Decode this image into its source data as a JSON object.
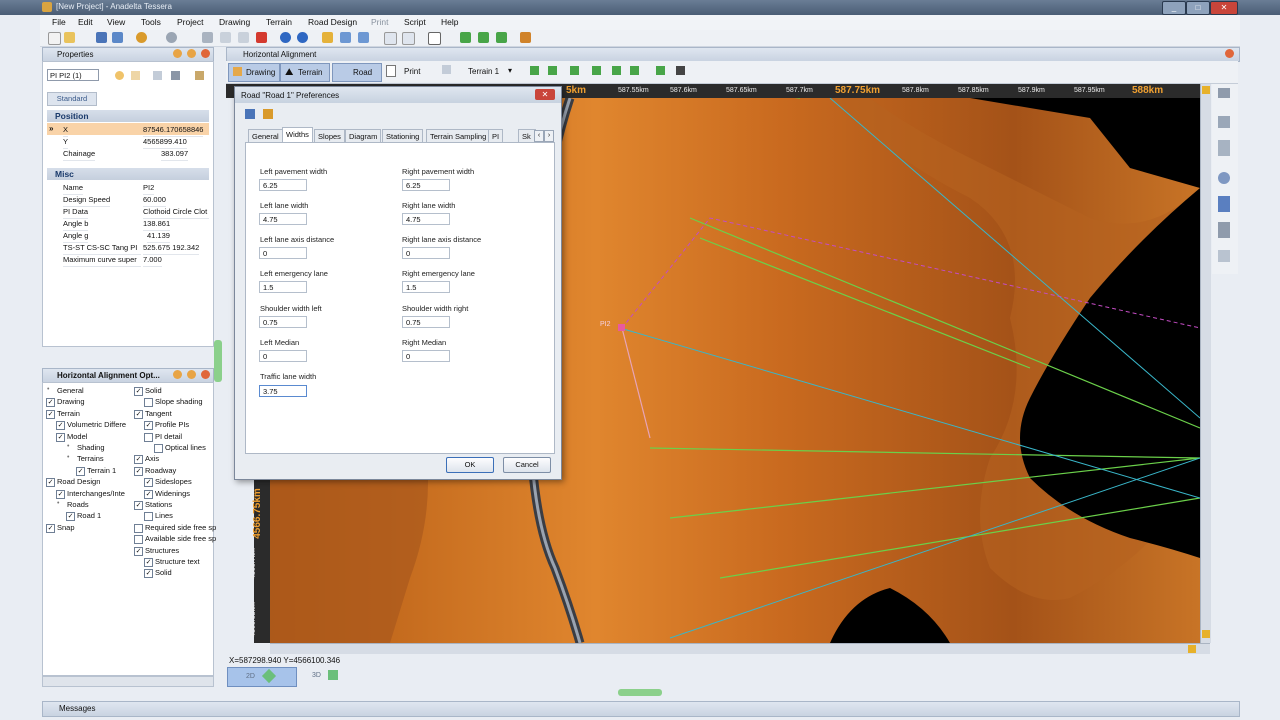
{
  "window": {
    "title": "[New Project] - Anadelta Tessera",
    "min": "_",
    "max": "□",
    "close": "✕"
  },
  "menu": [
    "File",
    "Edit",
    "View",
    "Tools",
    "Project",
    "Drawing",
    "Terrain",
    "Road Design",
    "Print",
    "Script",
    "Help"
  ],
  "properties": {
    "header": "Properties",
    "selector": "PI PI2 (1)",
    "tab": "Standard",
    "position": {
      "title": "Position",
      "rows": [
        [
          "X",
          "87546.170658846"
        ],
        [
          "Y",
          "4565899.410"
        ],
        [
          "Chainage",
          "383.097"
        ]
      ]
    },
    "misc": {
      "title": "Misc",
      "rows": [
        [
          "Name",
          "PI2"
        ],
        [
          "Design Speed",
          "60.000"
        ],
        [
          "PI Data",
          "Clothoid Circle Clot"
        ],
        [
          "Angle b",
          "138.861"
        ],
        [
          "Angle g",
          "41.139"
        ],
        [
          "TS-ST CS-SC Tang PI",
          "525.675  192.342"
        ],
        [
          "Maximum curve super",
          "7.000"
        ]
      ]
    }
  },
  "options": {
    "header": "Horizontal Alignment Opt...",
    "left": [
      {
        "label": "General",
        "indent": 0,
        "cb": null
      },
      {
        "label": "Drawing",
        "indent": 0,
        "cb": true
      },
      {
        "label": "Terrain",
        "indent": 0,
        "cb": true
      },
      {
        "label": "Volumetric Differe",
        "indent": 1,
        "cb": true
      },
      {
        "label": "Model",
        "indent": 1,
        "cb": true
      },
      {
        "label": "Shading",
        "indent": 2,
        "cb": null
      },
      {
        "label": "Terrains",
        "indent": 2,
        "cb": null
      },
      {
        "label": "Terrain 1",
        "indent": 3,
        "cb": true
      },
      {
        "label": "Road Design",
        "indent": 0,
        "cb": true
      },
      {
        "label": "Interchanges/Inte",
        "indent": 1,
        "cb": true
      },
      {
        "label": "Roads",
        "indent": 1,
        "cb": null
      },
      {
        "label": "Road 1",
        "indent": 2,
        "cb": true
      },
      {
        "label": "Snap",
        "indent": 0,
        "cb": true
      }
    ],
    "right": [
      {
        "label": "Solid",
        "indent": 0,
        "cb": true
      },
      {
        "label": "Slope shading",
        "indent": 1,
        "cb": false
      },
      {
        "label": "Tangent",
        "indent": 0,
        "cb": true
      },
      {
        "label": "Profile PIs",
        "indent": 1,
        "cb": true
      },
      {
        "label": "PI detail",
        "indent": 1,
        "cb": false
      },
      {
        "label": "Optical lines",
        "indent": 2,
        "cb": false
      },
      {
        "label": "Axis",
        "indent": 0,
        "cb": true
      },
      {
        "label": "Roadway",
        "indent": 0,
        "cb": true
      },
      {
        "label": "Sideslopes",
        "indent": 1,
        "cb": true
      },
      {
        "label": "Widenings",
        "indent": 1,
        "cb": true
      },
      {
        "label": "Stations",
        "indent": 0,
        "cb": true
      },
      {
        "label": "Lines",
        "indent": 1,
        "cb": false
      },
      {
        "label": "Required side free sp",
        "indent": 0,
        "cb": false
      },
      {
        "label": "Available side free sp",
        "indent": 0,
        "cb": false
      },
      {
        "label": "Structures",
        "indent": 0,
        "cb": true
      },
      {
        "label": "Structure text",
        "indent": 1,
        "cb": true
      },
      {
        "label": "Solid",
        "indent": 1,
        "cb": true
      }
    ]
  },
  "view": {
    "header": "Horizontal Alignment",
    "tabs": {
      "drawing": "Drawing",
      "terrain": "Terrain",
      "road": "Road",
      "print": "Print",
      "terrain_select": "Terrain 1"
    },
    "ruler_top": [
      "5km",
      "587.55km",
      "587.6km",
      "587.65km",
      "587.7km",
      "587.75km",
      "587.8km",
      "587.85km",
      "587.9km",
      "587.95km",
      "588km"
    ],
    "ruler_left": [
      "4566.75km",
      "4566.7km",
      "4566.65km"
    ],
    "pi_label": "PI2",
    "coords": "X=587298.940  Y=4566100.346",
    "mode_tabs": [
      "2D",
      "3D"
    ]
  },
  "dialog": {
    "title": "Road \"Road 1\" Preferences",
    "tabs": [
      "General",
      "Widths",
      "Slopes",
      "Diagram",
      "Stationing",
      "Terrain Sampling",
      "PI",
      "Sk"
    ],
    "active_tab": "Widths",
    "fields": {
      "left_pavement": {
        "label": "Left pavement width",
        "value": "6.25"
      },
      "right_pavement": {
        "label": "Right pavement width",
        "value": "6.25"
      },
      "left_lane": {
        "label": "Left lane width",
        "value": "4.75"
      },
      "right_lane": {
        "label": "Right lane width",
        "value": "4.75"
      },
      "left_axis": {
        "label": "Left lane axis distance",
        "value": "0"
      },
      "right_axis": {
        "label": "Right lane axis distance",
        "value": "0"
      },
      "left_emerg": {
        "label": "Left emergency lane",
        "value": "1.5"
      },
      "right_emerg": {
        "label": "Right emergency lane",
        "value": "1.5"
      },
      "shoulder_left": {
        "label": "Shoulder width left",
        "value": "0.75"
      },
      "shoulder_right": {
        "label": "Shoulder width right",
        "value": "0.75"
      },
      "left_median": {
        "label": "Left Median",
        "value": "0"
      },
      "right_median": {
        "label": "Right Median",
        "value": "0"
      },
      "traffic_lane": {
        "label": "Traffic lane width",
        "value": "3.75"
      }
    },
    "ok": "OK",
    "cancel": "Cancel"
  },
  "messages": {
    "header": "Messages"
  },
  "colors": {
    "terrain_dark": "#b55a14",
    "terrain_light": "#e8953a",
    "road": "#5a6472",
    "accent": "#3b6fb8"
  }
}
